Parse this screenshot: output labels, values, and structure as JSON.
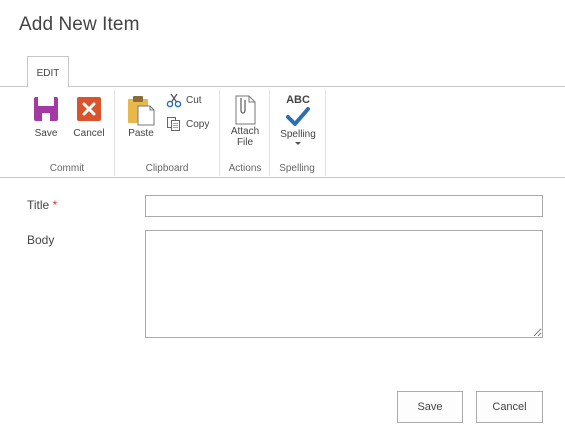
{
  "page": {
    "title": "Add New Item"
  },
  "ribbon": {
    "tab": "EDIT",
    "groups": {
      "commit": {
        "label": "Commit",
        "save": "Save",
        "cancel": "Cancel"
      },
      "clipboard": {
        "label": "Clipboard",
        "paste": "Paste",
        "cut": "Cut",
        "copy": "Copy"
      },
      "actions": {
        "label": "Actions",
        "attach_line1": "Attach",
        "attach_line2": "File"
      },
      "spelling": {
        "label": "Spelling",
        "spelling": "Spelling",
        "abc": "ABC"
      }
    }
  },
  "form": {
    "title_label": "Title",
    "required_marker": "*",
    "title_value": "",
    "body_label": "Body",
    "body_value": ""
  },
  "buttons": {
    "save": "Save",
    "cancel": "Cancel"
  },
  "colors": {
    "save_icon": "#a33aa3",
    "cancel_icon": "#d9542c",
    "check_icon": "#2b6fb0",
    "paste_icon": "#e8b84a",
    "required": "#c03a3a"
  }
}
